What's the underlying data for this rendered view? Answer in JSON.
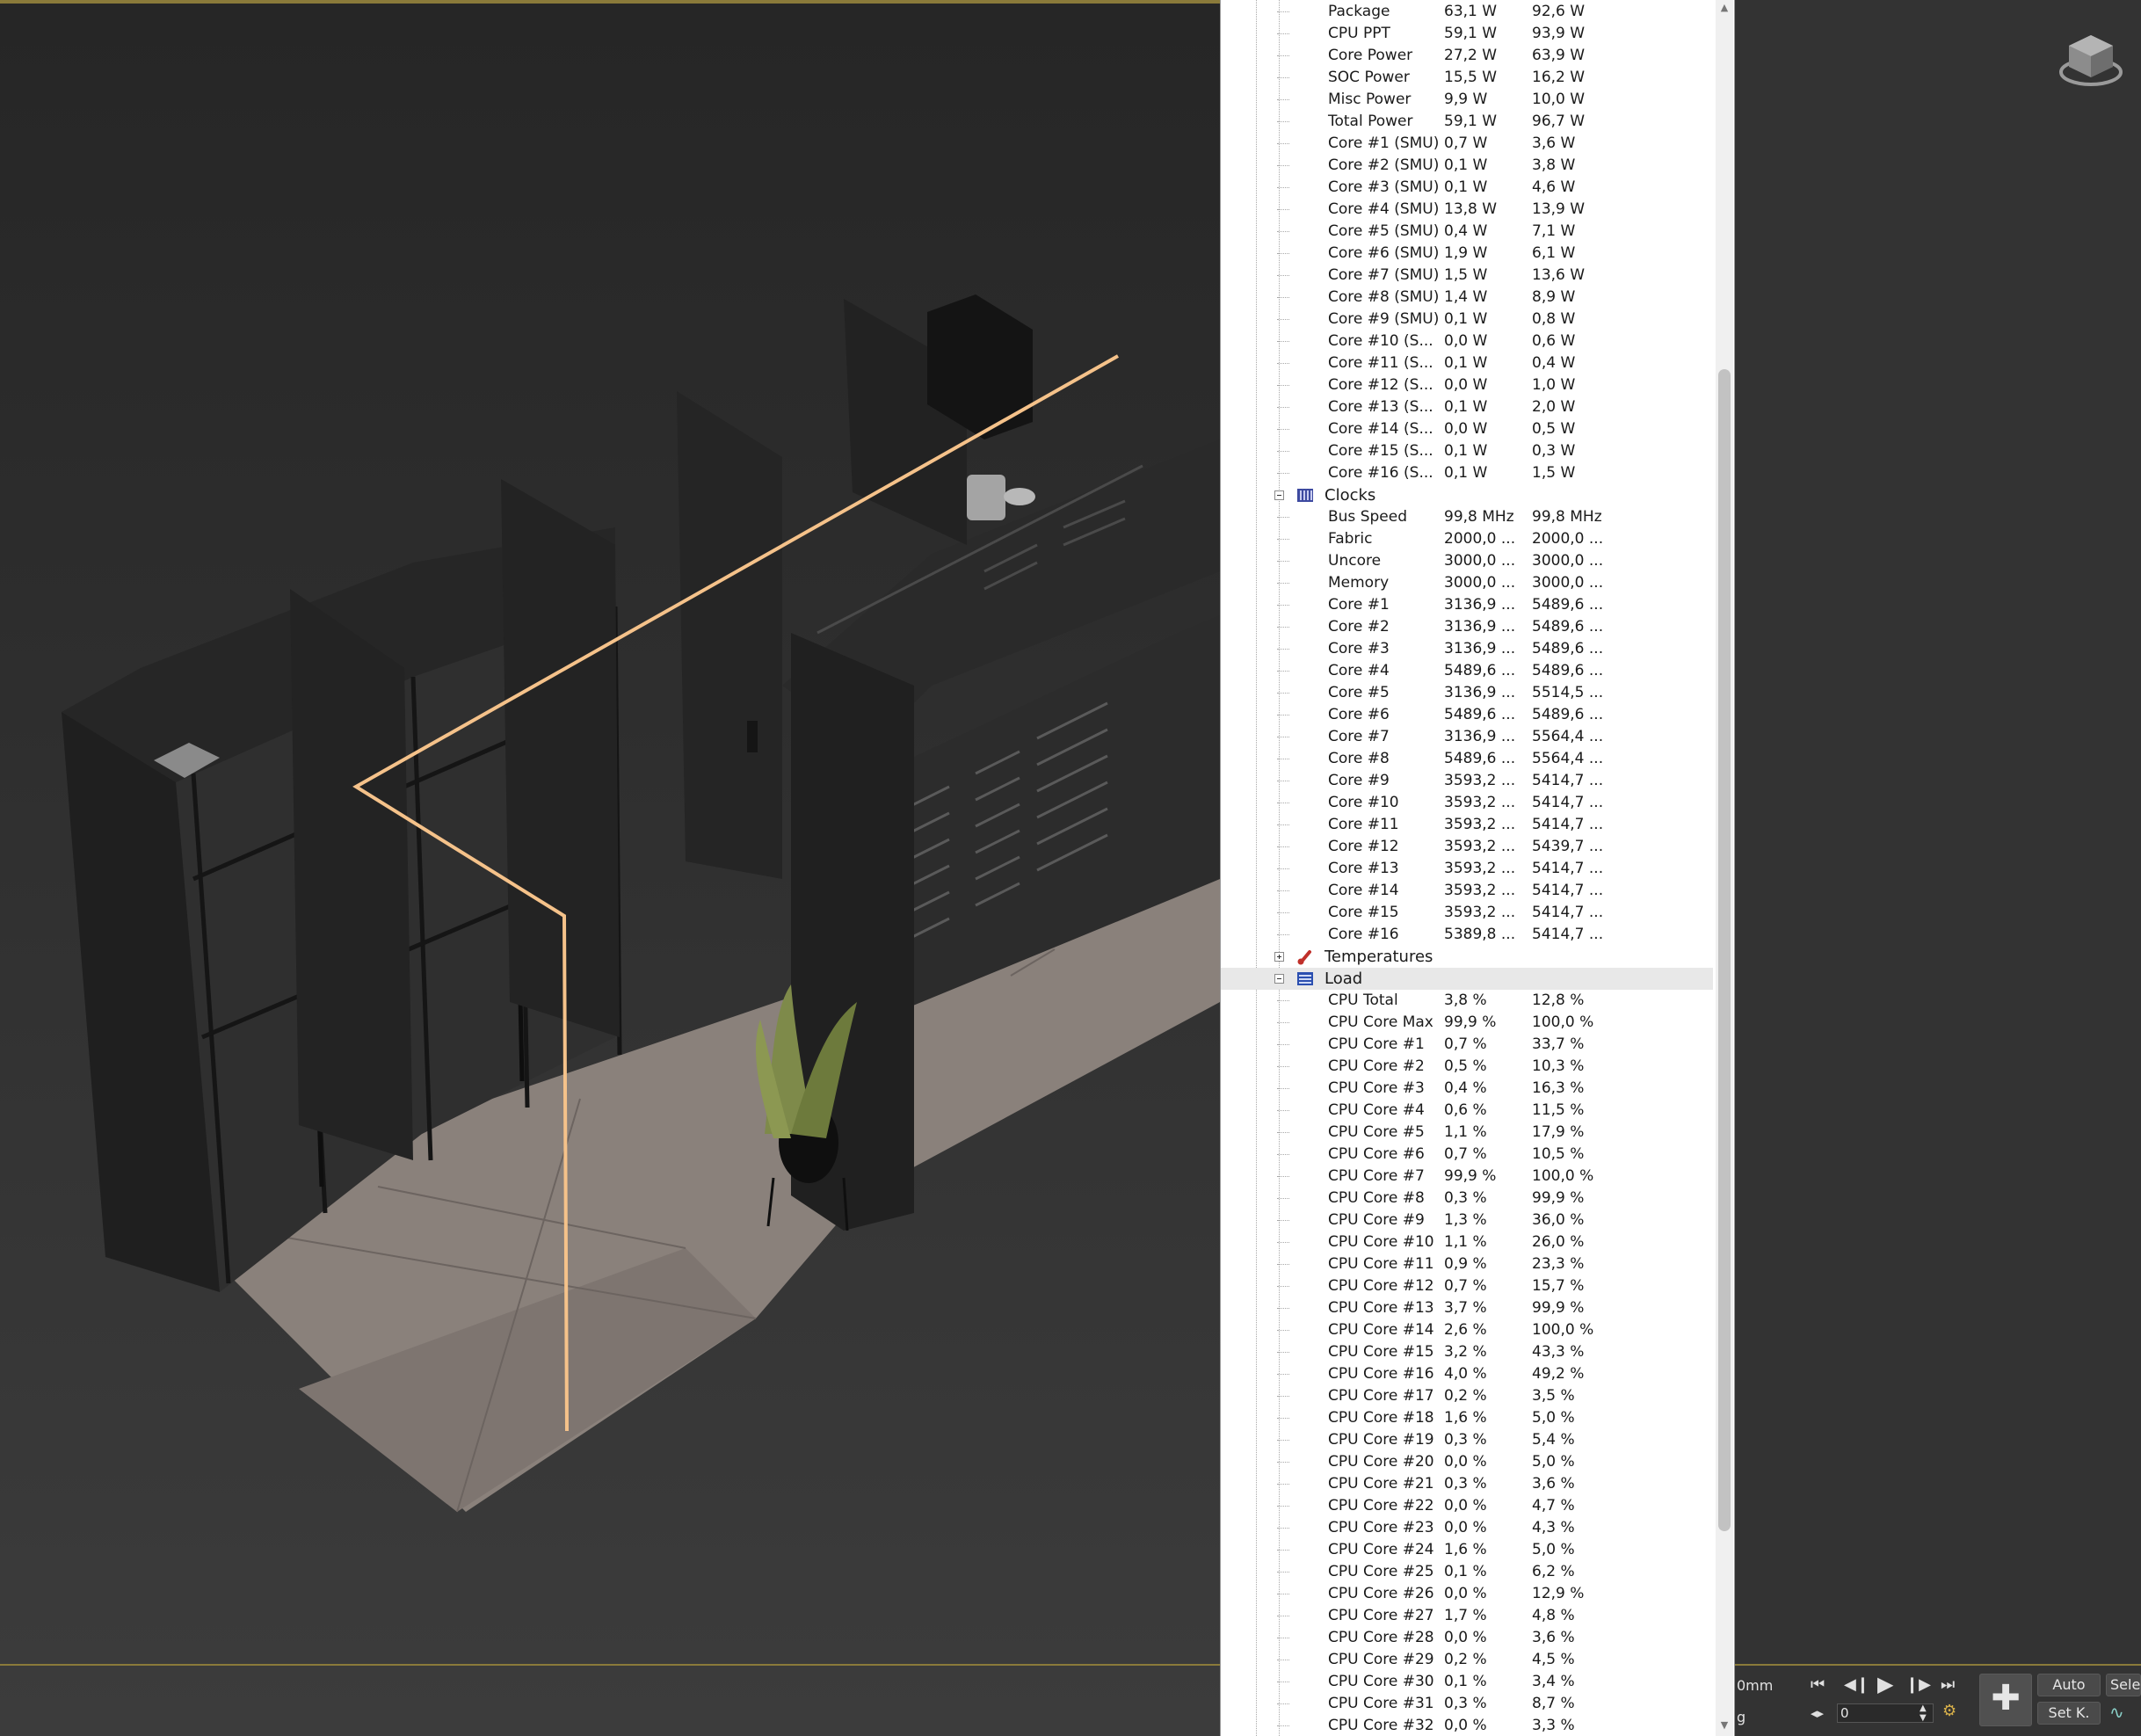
{
  "sensors": {
    "power_rows": [
      {
        "name": "Package",
        "value": "63,1 W",
        "max": "92,6 W"
      },
      {
        "name": "CPU PPT",
        "value": "59,1 W",
        "max": "93,9 W"
      },
      {
        "name": "Core Power",
        "value": "27,2 W",
        "max": "63,9 W"
      },
      {
        "name": "SOC Power",
        "value": "15,5 W",
        "max": "16,2 W"
      },
      {
        "name": "Misc Power",
        "value": "9,9 W",
        "max": "10,0 W"
      },
      {
        "name": "Total Power",
        "value": "59,1 W",
        "max": "96,7 W"
      },
      {
        "name": "Core #1 (SMU)",
        "value": "0,7 W",
        "max": "3,6 W"
      },
      {
        "name": "Core #2 (SMU)",
        "value": "0,1 W",
        "max": "3,8 W"
      },
      {
        "name": "Core #3 (SMU)",
        "value": "0,1 W",
        "max": "4,6 W"
      },
      {
        "name": "Core #4 (SMU)",
        "value": "13,8 W",
        "max": "13,9 W"
      },
      {
        "name": "Core #5 (SMU)",
        "value": "0,4 W",
        "max": "7,1 W"
      },
      {
        "name": "Core #6 (SMU)",
        "value": "1,9 W",
        "max": "6,1 W"
      },
      {
        "name": "Core #7 (SMU)",
        "value": "1,5 W",
        "max": "13,6 W"
      },
      {
        "name": "Core #8 (SMU)",
        "value": "1,4 W",
        "max": "8,9 W"
      },
      {
        "name": "Core #9 (SMU)",
        "value": "0,1 W",
        "max": "0,8 W"
      },
      {
        "name": "Core #10 (S...",
        "value": "0,0 W",
        "max": "0,6 W"
      },
      {
        "name": "Core #11 (S...",
        "value": "0,1 W",
        "max": "0,4 W"
      },
      {
        "name": "Core #12 (S...",
        "value": "0,0 W",
        "max": "1,0 W"
      },
      {
        "name": "Core #13 (S...",
        "value": "0,1 W",
        "max": "2,0 W"
      },
      {
        "name": "Core #14 (S...",
        "value": "0,0 W",
        "max": "0,5 W"
      },
      {
        "name": "Core #15 (S...",
        "value": "0,1 W",
        "max": "0,3 W"
      },
      {
        "name": "Core #16 (S...",
        "value": "0,1 W",
        "max": "1,5 W"
      }
    ],
    "clocks": {
      "label": "Clocks",
      "rows": [
        {
          "name": "Bus Speed",
          "value": "99,8 MHz",
          "max": "99,8 MHz"
        },
        {
          "name": "Fabric",
          "value": "2000,0 ...",
          "max": "2000,0 ..."
        },
        {
          "name": "Uncore",
          "value": "3000,0 ...",
          "max": "3000,0 ..."
        },
        {
          "name": "Memory",
          "value": "3000,0 ...",
          "max": "3000,0 ..."
        },
        {
          "name": "Core #1",
          "value": "3136,9 ...",
          "max": "5489,6 ..."
        },
        {
          "name": "Core #2",
          "value": "3136,9 ...",
          "max": "5489,6 ..."
        },
        {
          "name": "Core #3",
          "value": "3136,9 ...",
          "max": "5489,6 ..."
        },
        {
          "name": "Core #4",
          "value": "5489,6 ...",
          "max": "5489,6 ..."
        },
        {
          "name": "Core #5",
          "value": "3136,9 ...",
          "max": "5514,5 ..."
        },
        {
          "name": "Core #6",
          "value": "5489,6 ...",
          "max": "5489,6 ..."
        },
        {
          "name": "Core #7",
          "value": "3136,9 ...",
          "max": "5564,4 ..."
        },
        {
          "name": "Core #8",
          "value": "5489,6 ...",
          "max": "5564,4 ..."
        },
        {
          "name": "Core #9",
          "value": "3593,2 ...",
          "max": "5414,7 ..."
        },
        {
          "name": "Core #10",
          "value": "3593,2 ...",
          "max": "5414,7 ..."
        },
        {
          "name": "Core #11",
          "value": "3593,2 ...",
          "max": "5414,7 ..."
        },
        {
          "name": "Core #12",
          "value": "3593,2 ...",
          "max": "5439,7 ..."
        },
        {
          "name": "Core #13",
          "value": "3593,2 ...",
          "max": "5414,7 ..."
        },
        {
          "name": "Core #14",
          "value": "3593,2 ...",
          "max": "5414,7 ..."
        },
        {
          "name": "Core #15",
          "value": "3593,2 ...",
          "max": "5414,7 ..."
        },
        {
          "name": "Core #16",
          "value": "5389,8 ...",
          "max": "5414,7 ..."
        }
      ]
    },
    "temperatures": {
      "label": "Temperatures"
    },
    "load": {
      "label": "Load",
      "rows": [
        {
          "name": "CPU Total",
          "value": "3,8 %",
          "max": "12,8 %"
        },
        {
          "name": "CPU Core Max",
          "value": "99,9 %",
          "max": "100,0 %"
        },
        {
          "name": "CPU Core #1",
          "value": "0,7 %",
          "max": "33,7 %"
        },
        {
          "name": "CPU Core #2",
          "value": "0,5 %",
          "max": "10,3 %"
        },
        {
          "name": "CPU Core #3",
          "value": "0,4 %",
          "max": "16,3 %"
        },
        {
          "name": "CPU Core #4",
          "value": "0,6 %",
          "max": "11,5 %"
        },
        {
          "name": "CPU Core #5",
          "value": "1,1 %",
          "max": "17,9 %"
        },
        {
          "name": "CPU Core #6",
          "value": "0,7 %",
          "max": "10,5 %"
        },
        {
          "name": "CPU Core #7",
          "value": "99,9 %",
          "max": "100,0 %"
        },
        {
          "name": "CPU Core #8",
          "value": "0,3 %",
          "max": "99,9 %"
        },
        {
          "name": "CPU Core #9",
          "value": "1,3 %",
          "max": "36,0 %"
        },
        {
          "name": "CPU Core #10",
          "value": "1,1 %",
          "max": "26,0 %"
        },
        {
          "name": "CPU Core #11",
          "value": "0,9 %",
          "max": "23,3 %"
        },
        {
          "name": "CPU Core #12",
          "value": "0,7 %",
          "max": "15,7 %"
        },
        {
          "name": "CPU Core #13",
          "value": "3,7 %",
          "max": "99,9 %"
        },
        {
          "name": "CPU Core #14",
          "value": "2,6 %",
          "max": "100,0 %"
        },
        {
          "name": "CPU Core #15",
          "value": "3,2 %",
          "max": "43,3 %"
        },
        {
          "name": "CPU Core #16",
          "value": "4,0 %",
          "max": "49,2 %"
        },
        {
          "name": "CPU Core #17",
          "value": "0,2 %",
          "max": "3,5 %"
        },
        {
          "name": "CPU Core #18",
          "value": "1,6 %",
          "max": "5,0 %"
        },
        {
          "name": "CPU Core #19",
          "value": "0,3 %",
          "max": "5,4 %"
        },
        {
          "name": "CPU Core #20",
          "value": "0,0 %",
          "max": "5,0 %"
        },
        {
          "name": "CPU Core #21",
          "value": "0,3 %",
          "max": "3,6 %"
        },
        {
          "name": "CPU Core #22",
          "value": "0,0 %",
          "max": "4,7 %"
        },
        {
          "name": "CPU Core #23",
          "value": "0,0 %",
          "max": "4,3 %"
        },
        {
          "name": "CPU Core #24",
          "value": "1,6 %",
          "max": "5,0 %"
        },
        {
          "name": "CPU Core #25",
          "value": "0,1 %",
          "max": "6,2 %"
        },
        {
          "name": "CPU Core #26",
          "value": "0,0 %",
          "max": "12,9 %"
        },
        {
          "name": "CPU Core #27",
          "value": "1,7 %",
          "max": "4,8 %"
        },
        {
          "name": "CPU Core #28",
          "value": "0,0 %",
          "max": "3,6 %"
        },
        {
          "name": "CPU Core #29",
          "value": "0,2 %",
          "max": "4,5 %"
        },
        {
          "name": "CPU Core #30",
          "value": "0,1 %",
          "max": "3,4 %"
        },
        {
          "name": "CPU Core #31",
          "value": "0,3 %",
          "max": "8,7 %"
        },
        {
          "name": "CPU Core #32",
          "value": "0,0 %",
          "max": "3,3 %"
        }
      ]
    }
  },
  "anim": {
    "units_label": "0mm",
    "units_label2": "g",
    "frame_value": "0",
    "auto_key": "Auto",
    "set_key": "Set K.",
    "selected": "Selec"
  },
  "icons": {
    "viewcube": "viewcube-icon",
    "clocks": "clock-bars-icon",
    "temperatures": "thermometer-icon",
    "load": "load-bars-icon"
  },
  "colors": {
    "accent_line": "#8a7a3a",
    "selection_curve": "#f5c28a",
    "panel_bg": "#ffffff"
  }
}
